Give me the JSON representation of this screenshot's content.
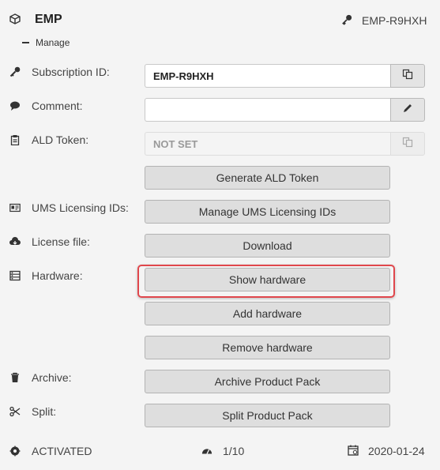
{
  "header": {
    "title": "EMP",
    "manage_label": "Manage",
    "product_key": "EMP-R9HXH"
  },
  "rows": {
    "subscription": {
      "label": "Subscription ID:",
      "value": "EMP-R9HXH"
    },
    "comment": {
      "label": "Comment:",
      "value": ""
    },
    "ald_token": {
      "label": "ALD Token:",
      "value": "NOT SET"
    },
    "generate_token": {
      "button": "Generate ALD Token"
    },
    "ums": {
      "label": "UMS Licensing IDs:",
      "button": "Manage UMS Licensing IDs"
    },
    "license": {
      "label": "License file:",
      "button": "Download"
    },
    "hardware": {
      "label": "Hardware:",
      "show_button": "Show hardware",
      "add_button": "Add hardware",
      "remove_button": "Remove hardware"
    },
    "archive": {
      "label": "Archive:",
      "button": "Archive Product Pack"
    },
    "split": {
      "label": "Split:",
      "button": "Split Product Pack"
    }
  },
  "footer": {
    "status": "ACTIVATED",
    "usage": "1/10",
    "date": "2020-01-24"
  },
  "colors": {
    "highlight": "#e0474c",
    "button_bg": "#dedede",
    "page_bg": "#f4f4f4"
  }
}
